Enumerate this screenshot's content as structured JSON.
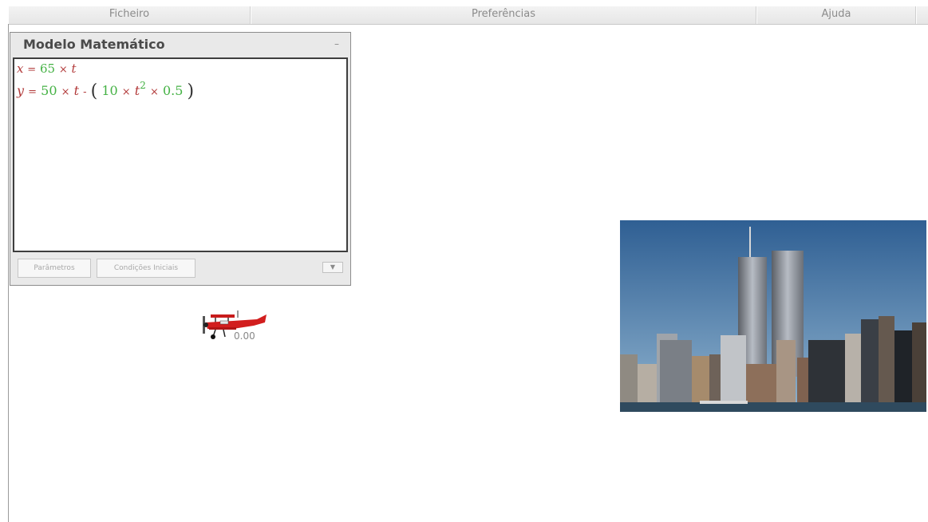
{
  "menu": {
    "items": [
      "Ficheiro",
      "Preferências",
      "Ajuda",
      ""
    ]
  },
  "model": {
    "title": "Modelo Matemático",
    "minimize_symbol": "–",
    "eq1": {
      "var": "x",
      "eq": "=",
      "coef": "65",
      "times": "×",
      "t": "t"
    },
    "eq2": {
      "var": "y",
      "eq": "=",
      "coef": "50",
      "times1": "×",
      "t1": "t",
      "minus": "-",
      "lparen": "(",
      "coef2": "10",
      "times2": "×",
      "t2": "t",
      "exp": "2",
      "times3": "×",
      "factor": "0.5",
      "rparen": ")"
    },
    "buttons": {
      "params": "Parâmetros",
      "conditions": "Condições Iniciais",
      "dropdown": "▼"
    }
  },
  "plane": {
    "readout": "0.00"
  },
  "colors": {
    "variable": "#b23a3a",
    "number": "#45b245",
    "plane": "#d21e1e",
    "sky": "#4a7aa8"
  }
}
